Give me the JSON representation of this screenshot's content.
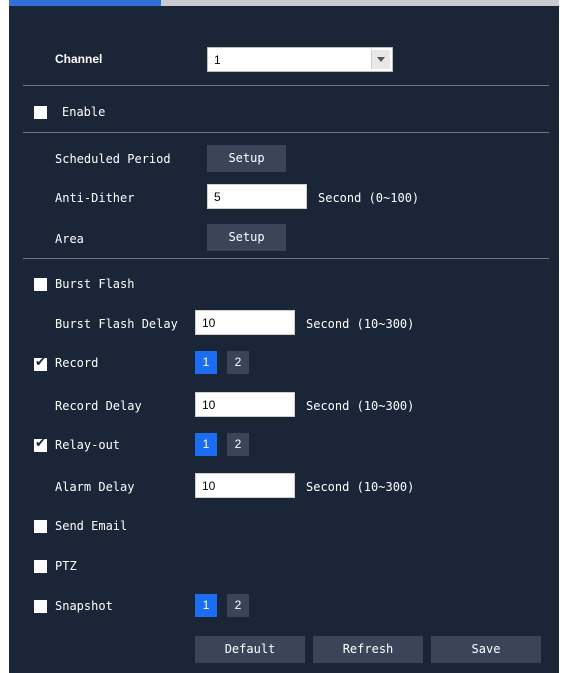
{
  "channel": {
    "label": "Channel",
    "value": "1"
  },
  "enable": {
    "label": "Enable",
    "checked": false
  },
  "scheduled_period": {
    "label": "Scheduled Period",
    "button": "Setup"
  },
  "anti_dither": {
    "label": "Anti-Dither",
    "value": "5",
    "unit": "Second (0~100)"
  },
  "area": {
    "label": "Area",
    "button": "Setup"
  },
  "burst_flash": {
    "label": "Burst Flash",
    "checked": false
  },
  "burst_flash_delay": {
    "label": "Burst Flash Delay",
    "value": "10",
    "unit": "Second (10~300)"
  },
  "record": {
    "label": "Record",
    "checked": true,
    "channels": [
      "1",
      "2"
    ],
    "selected": "1"
  },
  "record_delay": {
    "label": "Record Delay",
    "value": "10",
    "unit": "Second (10~300)"
  },
  "relay_out": {
    "label": "Relay-out",
    "checked": true,
    "channels": [
      "1",
      "2"
    ],
    "selected": "1"
  },
  "alarm_delay": {
    "label": "Alarm Delay",
    "value": "10",
    "unit": "Second (10~300)"
  },
  "send_email": {
    "label": "Send Email",
    "checked": false
  },
  "ptz": {
    "label": "PTZ",
    "checked": false
  },
  "snapshot": {
    "label": "Snapshot",
    "checked": false,
    "channels": [
      "1",
      "2"
    ],
    "selected": "1"
  },
  "footer": {
    "default": "Default",
    "refresh": "Refresh",
    "save": "Save"
  },
  "colors": {
    "panel": "#1b2538",
    "accent": "#1b6df2",
    "button": "#3a4559"
  },
  "icons": {
    "check": "✔",
    "dropdown": "chevron-down-icon"
  }
}
